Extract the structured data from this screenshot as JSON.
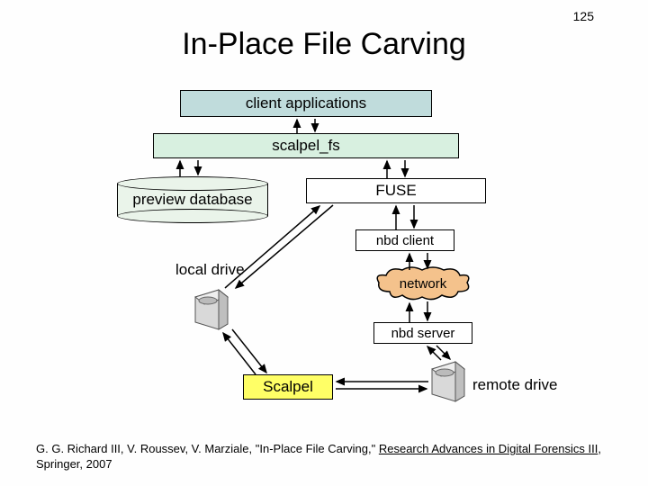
{
  "page_number": "125",
  "title": "In-Place File Carving",
  "boxes": {
    "client_apps": "client applications",
    "scalpel_fs": "scalpel_fs",
    "fuse": "FUSE",
    "preview_db": "preview database",
    "nbd_client": "nbd client",
    "nbd_server": "nbd server",
    "scalpel": "Scalpel",
    "network": "network",
    "local_drive": "local drive",
    "remote_drive": "remote drive"
  },
  "citation": {
    "authors": "G. G. Richard III, V. Roussev, V. Marziale, ",
    "paper_title": "\"In-Place File Carving,\" ",
    "venue": "Research Advances in Digital Forensics III",
    "rest": ", Springer, 2007"
  }
}
